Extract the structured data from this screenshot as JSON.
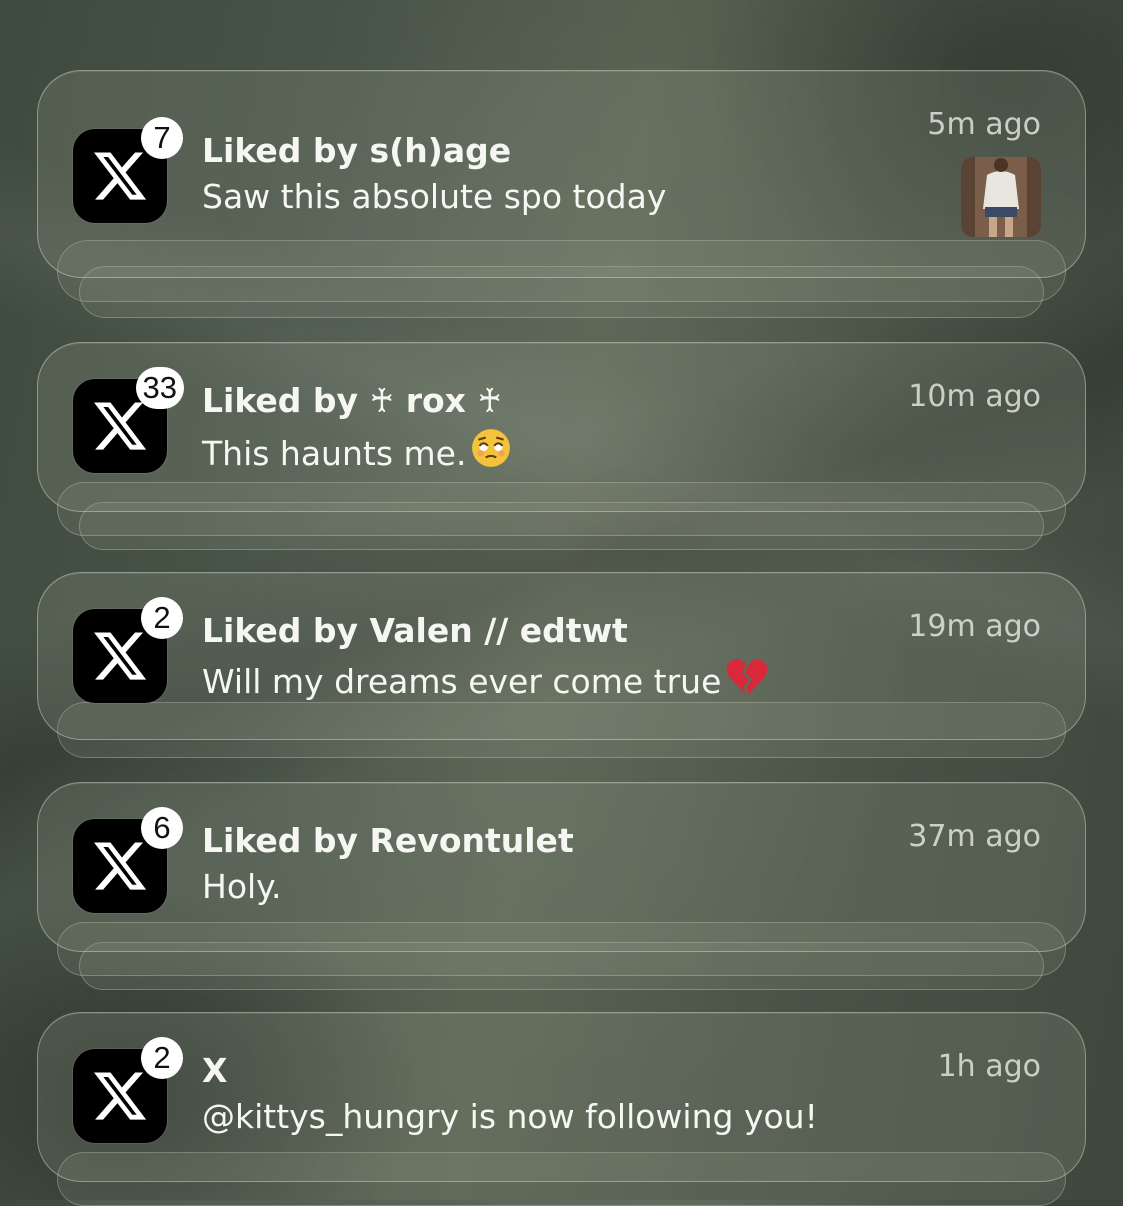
{
  "notifications": [
    {
      "app": "X",
      "badge": "7",
      "title": "Liked by s(h)age",
      "body": "Saw this absolute spo today",
      "time": "5m ago",
      "has_thumbnail": true,
      "emoji": ""
    },
    {
      "app": "X",
      "badge": "33",
      "title": "Liked by ♰ rox ♰",
      "body": "This haunts me.",
      "time": "10m ago",
      "has_thumbnail": false,
      "emoji": "pleading-face"
    },
    {
      "app": "X",
      "badge": "2",
      "title": "Liked by Valen // edtwt",
      "body": "Will my dreams ever come true",
      "time": "19m ago",
      "has_thumbnail": false,
      "emoji": "broken-heart"
    },
    {
      "app": "X",
      "badge": "6",
      "title": "Liked by Revontulet",
      "body": "Holy.",
      "time": "37m ago",
      "has_thumbnail": false,
      "emoji": ""
    },
    {
      "app": "X",
      "badge": "2",
      "title": "X",
      "body": "@kittys_hungry is now following you!",
      "time": "1h ago",
      "has_thumbnail": false,
      "emoji": ""
    }
  ],
  "colors": {
    "background": "#4a5549",
    "card_text": "#f6f7f3",
    "badge_bg": "#ffffff",
    "icon_bg": "#000000",
    "broken_heart": "#d8283a",
    "emoji_face": "#f5c33b"
  }
}
